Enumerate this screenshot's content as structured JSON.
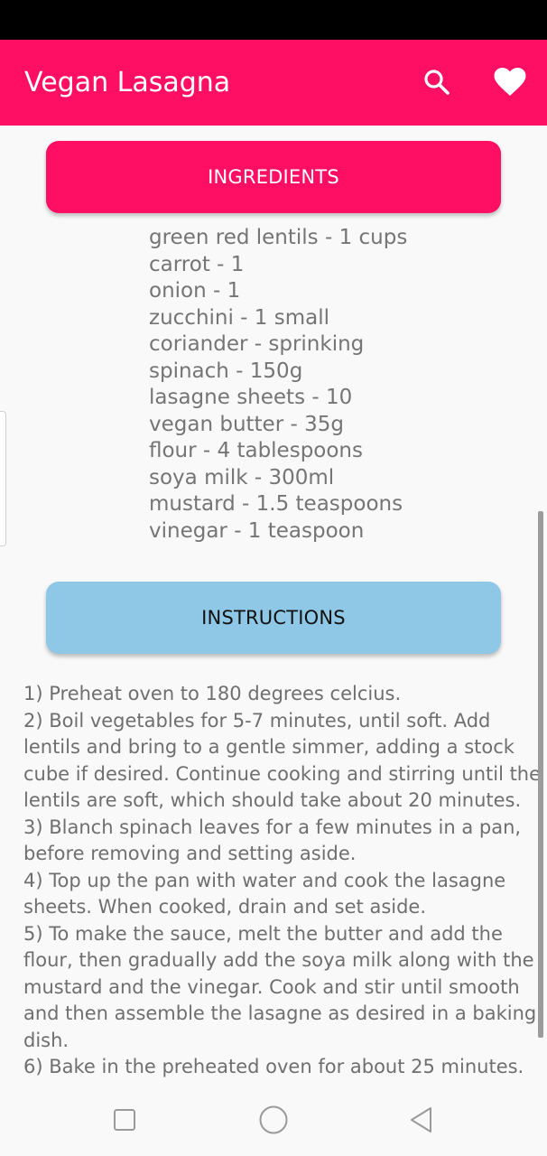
{
  "app_bar": {
    "title": "Vegan Lasagna",
    "color": "#ff0f63",
    "actions": [
      {
        "icon": "search-icon"
      },
      {
        "icon": "heart-icon"
      }
    ]
  },
  "ingredients_section": {
    "button_label": "INGREDIENTS",
    "button_color": "#ff0f63",
    "items": [
      "green red lentils - 1 cups",
      "carrot - 1",
      "onion - 1",
      "zucchini - 1 small",
      "coriander - sprinking",
      "spinach - 150g",
      "lasagne sheets - 10",
      "vegan butter - 35g",
      "flour - 4 tablespoons",
      "soya milk - 300ml",
      "mustard - 1.5 teaspoons",
      "vinegar - 1 teaspoon"
    ]
  },
  "instructions_section": {
    "button_label": "INSTRUCTIONS",
    "button_color": "#8ec8e6",
    "steps": [
      "1) Preheat oven to 180 degrees celcius.",
      "2) Boil vegetables for 5-7 minutes, until soft. Add lentils and bring to a gentle simmer, adding a stock cube if desired. Continue cooking and stirring until the lentils are soft, which should take about 20 minutes.",
      "3) Blanch spinach leaves for a few minutes in a pan, before removing and setting aside.",
      "4) Top up the pan with water and cook the lasagne sheets. When cooked, drain and set aside.",
      "5) To make the sauce, melt the butter and add the flour, then gradually add the soya milk along with the mustard and the vinegar. Cook and stir until smooth and then assemble the lasagne as desired in a baking dish.",
      "6) Bake in the preheated oven for about 25 minutes."
    ]
  },
  "nav_bar": {
    "buttons": [
      {
        "icon": "recents-square-icon"
      },
      {
        "icon": "home-circle-icon"
      },
      {
        "icon": "back-triangle-icon"
      }
    ]
  }
}
